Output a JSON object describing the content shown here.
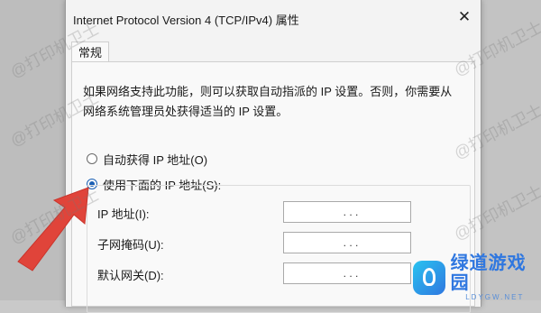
{
  "dialog": {
    "title": "Internet Protocol Version 4 (TCP/IPv4) 属性",
    "close_glyph": "✕"
  },
  "tabs": [
    {
      "label": "常规",
      "active": true
    }
  ],
  "description": "如果网络支持此功能，则可以获取自动指派的 IP 设置。否则，你需要从网络系统管理员处获得适当的 IP 设置。",
  "options": {
    "auto_ip": {
      "label": "自动获得 IP 地址(O)",
      "checked": false
    },
    "manual_ip": {
      "label": "使用下面的 IP 地址(S):",
      "checked": true
    }
  },
  "fields": [
    {
      "label": "IP 地址(I):",
      "value": ". . ."
    },
    {
      "label": "子网掩码(U):",
      "value": ". . ."
    },
    {
      "label": "默认网关(D):",
      "value": ". . ."
    }
  ],
  "watermark_text": "@打印机卫士",
  "logo": {
    "name": "绿道游戏园",
    "domain": "LDYGW.NET"
  },
  "colors": {
    "accent": "#1a5fb4",
    "arrow": "#e0443a",
    "logo": "#2f77e0"
  },
  "icons": {
    "close": "close-icon",
    "annotation": "red-arrow"
  }
}
